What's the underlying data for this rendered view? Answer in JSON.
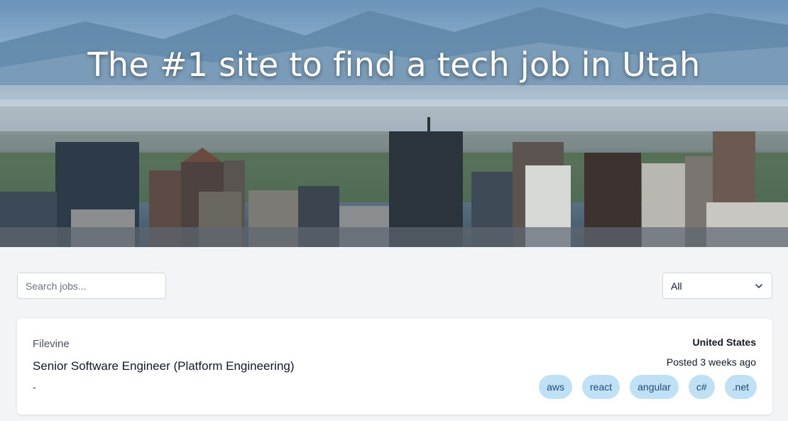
{
  "hero": {
    "title": "The #1 site to find a tech job in Utah"
  },
  "search": {
    "placeholder": "Search jobs...",
    "value": ""
  },
  "filter": {
    "selected": "All",
    "icon": "chevron-down-icon"
  },
  "jobs": [
    {
      "company": "Filevine",
      "title": "Senior Software Engineer (Platform Engineering)",
      "subtitle": "-",
      "location": "United States",
      "posted": "Posted 3 weeks ago",
      "tags": [
        "aws",
        "react",
        "angular",
        "c#",
        ".net"
      ]
    }
  ],
  "colors": {
    "background": "#f3f4f6",
    "card": "#ffffff",
    "tag_bg": "#bfe0f5",
    "tag_text": "#1f4e79"
  }
}
